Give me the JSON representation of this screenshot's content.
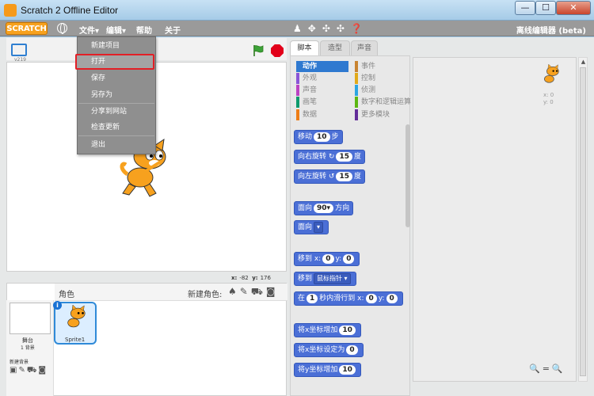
{
  "window": {
    "title": "Scratch 2 Offline Editor",
    "controls": {
      "minimize": "—",
      "maximize": "☐",
      "close": "✕"
    }
  },
  "menubar": {
    "logo": "SCRATCH",
    "items": [
      {
        "label": "文件▾"
      },
      {
        "label": "编辑▾"
      },
      {
        "label": "帮助"
      },
      {
        "label": "关于"
      }
    ],
    "toolbar_icons": "♟✥✣✣❓",
    "right_label": "离线编辑器 (beta)"
  },
  "file_menu": {
    "items": [
      {
        "label": "新建项目"
      },
      {
        "label": "打开",
        "highlighted": true
      },
      {
        "label": "保存"
      },
      {
        "label": "另存为"
      },
      {
        "label": "分享到网站"
      },
      {
        "label": "检查更新"
      },
      {
        "label": "退出"
      }
    ]
  },
  "stage": {
    "version": "v219",
    "coords": {
      "x_label": "x:",
      "x": "-82",
      "y_label": "y:",
      "y": "176"
    }
  },
  "sprites": {
    "header_label": "角色",
    "new_sprite_label": "新建角色:",
    "new_sprite_icons": "♠✎⛟◙",
    "stage_label": "舞台",
    "backdrop_count": "1 背景",
    "new_backdrop_label": "新建背景",
    "new_backdrop_icons": "▣✎⛟◙",
    "sprite_name": "Sprite1"
  },
  "tabs": [
    {
      "label": "脚本"
    },
    {
      "label": "造型"
    },
    {
      "label": "声音"
    }
  ],
  "categories": [
    {
      "label": "动作",
      "color": "#4a6cd4",
      "selected": true
    },
    {
      "label": "外观",
      "color": "#8a55d7"
    },
    {
      "label": "声音",
      "color": "#bb42c3"
    },
    {
      "label": "画笔",
      "color": "#0e9a6c"
    },
    {
      "label": "数据",
      "color": "#ee7d16"
    },
    {
      "label": "事件",
      "color": "#c88330"
    },
    {
      "label": "控制",
      "color": "#e1a91a"
    },
    {
      "label": "侦测",
      "color": "#2ca5e2"
    },
    {
      "label": "数字和逻辑运算",
      "color": "#5cb712"
    },
    {
      "label": "更多模块",
      "color": "#632d99"
    }
  ],
  "blocks": {
    "move": {
      "pre": "移动",
      "val": "10",
      "post": "步"
    },
    "turn_right": {
      "pre": "向右旋转",
      "icon": "↻",
      "val": "15",
      "post": "度"
    },
    "turn_left": {
      "pre": "向左旋转",
      "icon": "↺",
      "val": "15",
      "post": "度"
    },
    "point_dir": {
      "pre": "面向",
      "val": "90▾",
      "post": "方向"
    },
    "point_towards": {
      "pre": "面向",
      "dd": "▾"
    },
    "goto_xy": {
      "pre": "移到 x:",
      "x": "0",
      "mid": "y:",
      "y": "0"
    },
    "goto": {
      "pre": "移到",
      "dd": "鼠标指针 ▾"
    },
    "glide": {
      "pre": "在",
      "secs": "1",
      "mid": "秒内滑行到 x:",
      "x": "0",
      "mid2": "y:",
      "y": "0"
    },
    "change_x": {
      "pre": "将x坐标增加",
      "val": "10"
    },
    "set_x": {
      "pre": "将x坐标设定为",
      "val": "0"
    },
    "change_y": {
      "pre": "将y坐标增加",
      "val": "10"
    }
  },
  "script_area": {
    "x_readout": "x: 0",
    "y_readout": "y: 0",
    "zoom_icons": "🔍=🔍"
  }
}
